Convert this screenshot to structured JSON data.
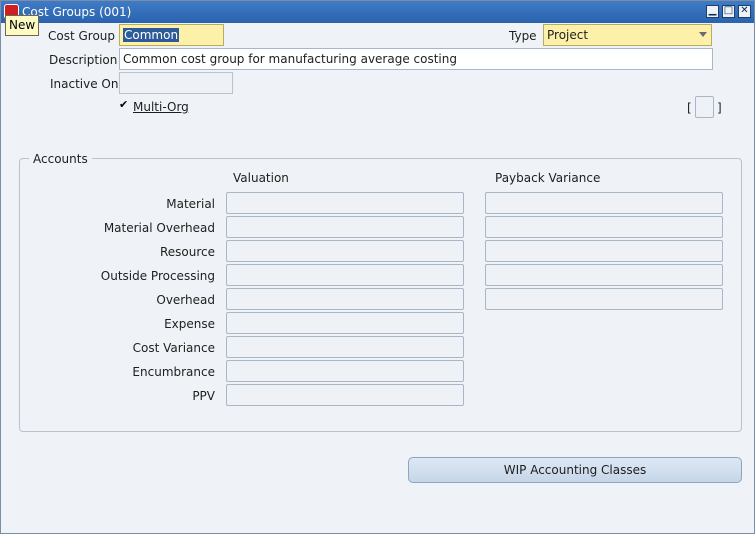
{
  "window": {
    "title": "Cost Groups (001)",
    "controls": {
      "minimize": "▁",
      "maximize": "□",
      "close": "✕"
    }
  },
  "tooltip": "New",
  "header": {
    "cost_group_label": "Cost Group",
    "cost_group_value": "Common",
    "type_label": "Type",
    "type_value": "Project",
    "description_label": "Description",
    "description_value": "Common cost group for manufacturing average costing",
    "inactive_on_label": "Inactive On",
    "inactive_on_value": "",
    "multi_org_label": "Multi-Org",
    "multi_org_checked": true,
    "multi_org_checkmark": "✔",
    "bracket_open": "[",
    "bracket_close": "]"
  },
  "accounts": {
    "group_title": "Accounts",
    "valuation_header": "Valuation",
    "payback_header": "Payback Variance",
    "rows": [
      {
        "label": "Material",
        "valuation": "",
        "payback": ""
      },
      {
        "label": "Material Overhead",
        "valuation": "",
        "payback": ""
      },
      {
        "label": "Resource",
        "valuation": "",
        "payback": ""
      },
      {
        "label": "Outside Processing",
        "valuation": "",
        "payback": ""
      },
      {
        "label": "Overhead",
        "valuation": "",
        "payback": ""
      },
      {
        "label": "Expense",
        "valuation": ""
      },
      {
        "label": "Cost Variance",
        "valuation": ""
      },
      {
        "label": "Encumbrance",
        "valuation": ""
      },
      {
        "label": "PPV",
        "valuation": ""
      }
    ]
  },
  "buttons": {
    "wip_accounting_classes": "WIP Accounting Classes"
  },
  "colors": {
    "title_bar": "#2f6db8",
    "required_field": "#fdf0a9",
    "selection": "#2d5b9a",
    "background": "#eff3f7"
  }
}
